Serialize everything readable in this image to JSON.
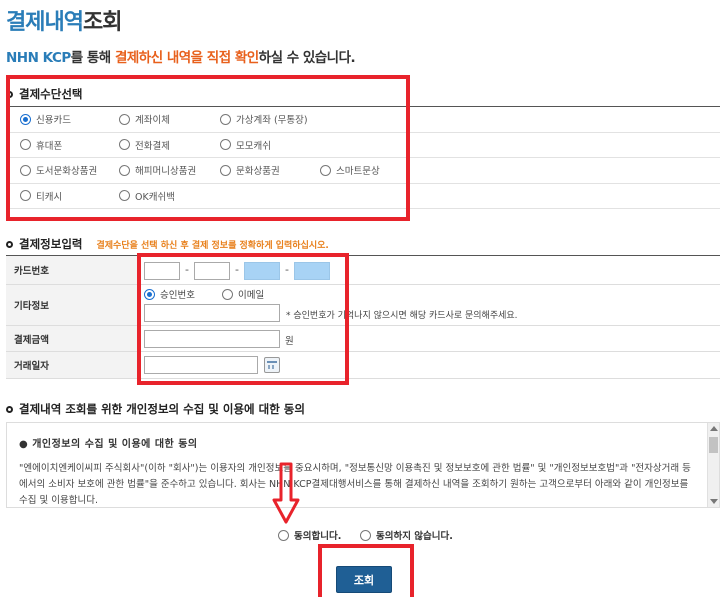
{
  "header": {
    "title_part1": "결제내역",
    "title_part2": "조회",
    "subtitle_prefix": "NHN KCP",
    "subtitle_mid": "를 통해 ",
    "subtitle_highlight": "결제하신 내역을 직접 확인",
    "subtitle_suffix": "하실 수 있습니다."
  },
  "payment_method": {
    "title": "결제수단선택",
    "rows": [
      [
        {
          "label": "신용카드",
          "selected": true
        },
        {
          "label": "계좌이체",
          "selected": false
        },
        {
          "label": "가상계좌 (무통장)",
          "selected": false
        }
      ],
      [
        {
          "label": "휴대폰",
          "selected": false
        },
        {
          "label": "전화결제",
          "selected": false
        },
        {
          "label": "모모캐쉬",
          "selected": false
        }
      ],
      [
        {
          "label": "도서문화상품권",
          "selected": false
        },
        {
          "label": "해피머니상품권",
          "selected": false
        },
        {
          "label": "문화상품권",
          "selected": false
        },
        {
          "label": "스마트문상",
          "selected": false
        }
      ],
      [
        {
          "label": "티캐시",
          "selected": false
        },
        {
          "label": "OK캐쉬백",
          "selected": false
        }
      ]
    ]
  },
  "payment_info": {
    "title": "결제정보입력",
    "note": "결제수단을 선택 하신 후 결제 정보를 정확하게 입력하십시오.",
    "card_number_label": "카드번호",
    "extra_info_label": "기타정보",
    "approval_no_label": "승인번호",
    "email_label": "이메일",
    "approval_hint": "* 승인번호가 기억나지 않으시면 해당 카드사로 문의해주세요.",
    "amount_label": "결제금액",
    "amount_unit": "원",
    "date_label": "거래일자",
    "dash": "-"
  },
  "consent": {
    "title": "결제내역 조회를 위한 개인정보의 수집 및 이용에 대한 동의",
    "box_heading": "● 개인정보의 수집 및 이용에 대한 동의",
    "body": "\"엔에이치엔케이씨피 주식회사\"(이하 \"회사\")는 이용자의 개인정보를 중요시하며, \"정보통신망 이용촉진 및 정보보호에 관한 법률\" 및 \"개인정보보호법\"과 \"전자상거래 등에서의 소비자 보호에 관한 법률\"을 준수하고 있습니다. 회사는 NHN KCP결제대행서비스를 통해 결제하신 내역을 조회하기 원하는 고객으로부터 아래와 같이 개인정보를 수집 및 이용합니다.",
    "agree_label": "동의합니다.",
    "disagree_label": "동의하지 않습니다."
  },
  "submit_label": "조회",
  "colors": {
    "accent_blue": "#2a7db8",
    "accent_orange": "#e8601c",
    "button": "#1f5f95",
    "highlight_red": "#e8232b"
  }
}
